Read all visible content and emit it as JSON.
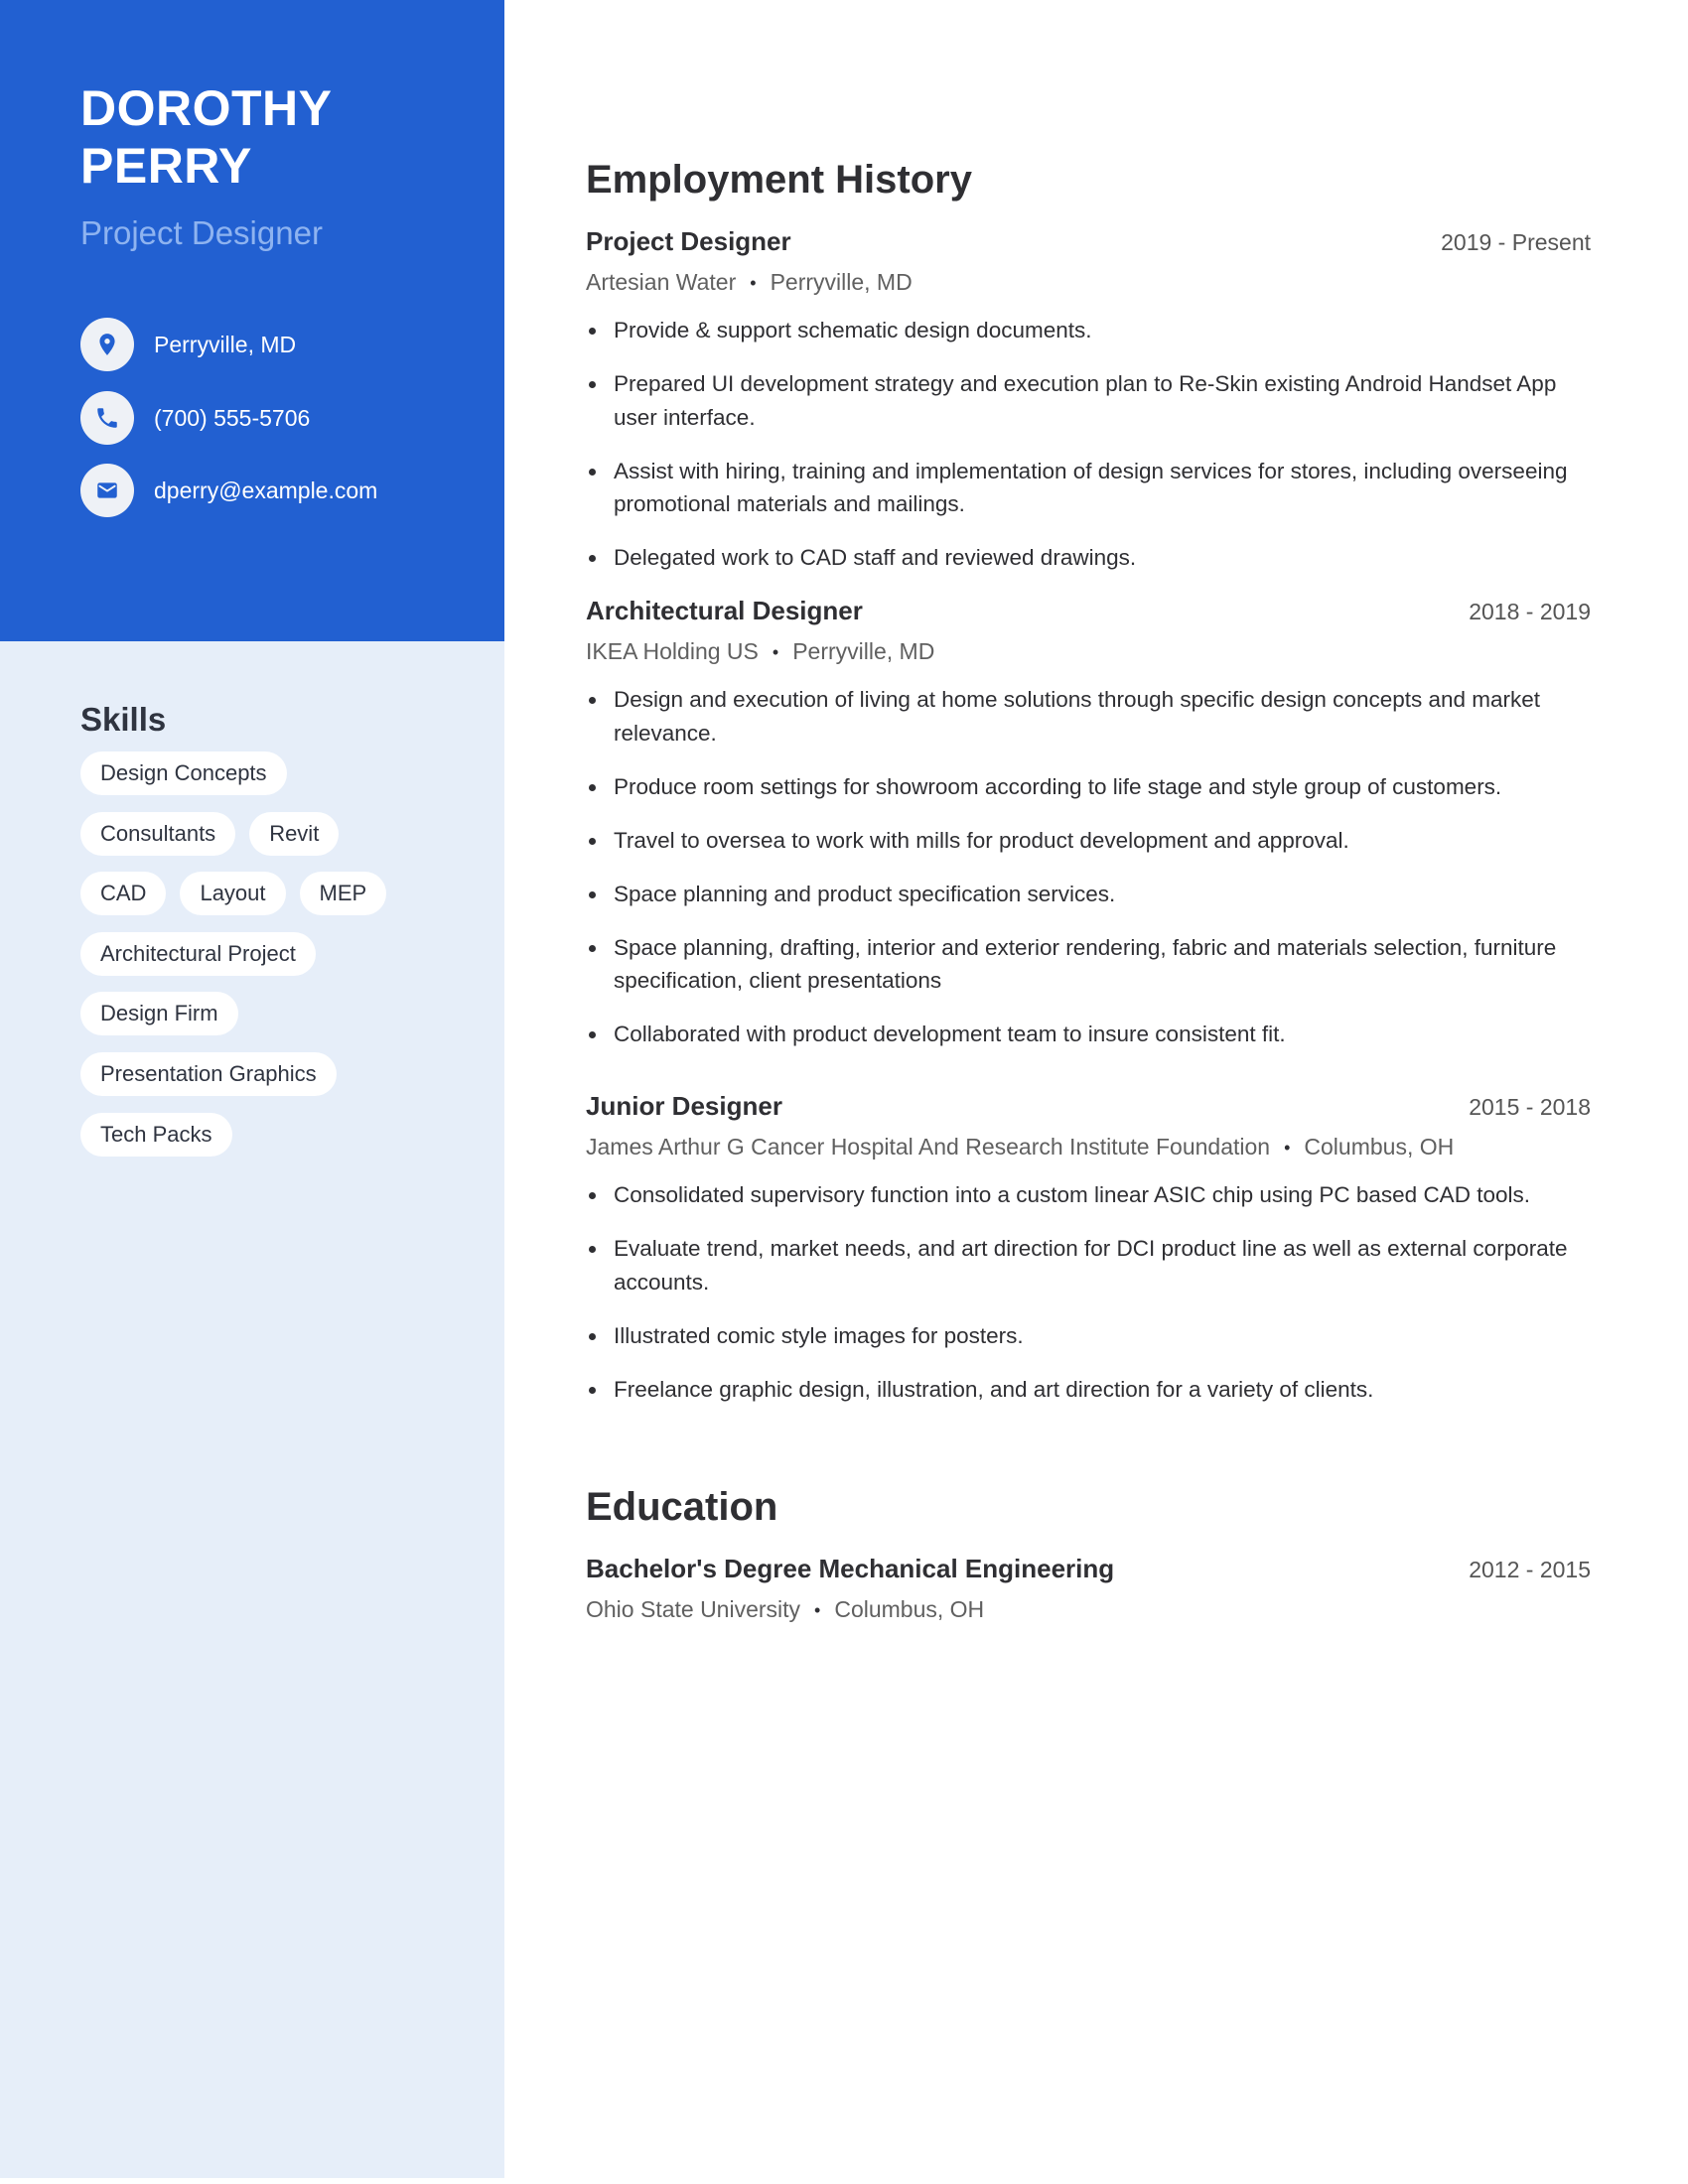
{
  "colors": {
    "accent": "#2260d1",
    "accent_light": "#8eb3f0",
    "sidebar_bg": "#e6eef9",
    "text": "#2f2f33",
    "muted": "#606060"
  },
  "profile": {
    "first_name": "DOROTHY",
    "last_name": "PERRY",
    "title": "Project Designer"
  },
  "contact": [
    {
      "icon": "location-pin-icon",
      "text": "Perryville, MD"
    },
    {
      "icon": "phone-icon",
      "text": "(700) 555-5706"
    },
    {
      "icon": "mail-icon",
      "text": "dperry@example.com"
    }
  ],
  "skills": {
    "title": "Skills",
    "rows": [
      [
        "Design Concepts"
      ],
      [
        "Consultants",
        "Revit"
      ],
      [
        "CAD",
        "Layout",
        "MEP"
      ],
      [
        "Architectural Project"
      ],
      [
        "Design Firm"
      ],
      [
        "Presentation Graphics"
      ],
      [
        "Tech Packs"
      ]
    ]
  },
  "employment": {
    "title": "Employment History",
    "jobs": [
      {
        "title": "Project Designer",
        "dates": "2019 - Present",
        "company": "Artesian Water",
        "location": "Perryville, MD",
        "bullets": [
          "Provide & support schematic design documents.",
          "Prepared UI development strategy and execution plan to Re-Skin existing Android Handset App user interface.",
          "Assist with hiring, training and implementation of design services for stores, including overseeing promotional materials and mailings.",
          "Delegated work to CAD staff and reviewed drawings."
        ]
      },
      {
        "title": "Architectural Designer",
        "dates": "2018 - 2019",
        "company": "IKEA Holding US",
        "location": "Perryville, MD",
        "bullets": [
          "Design and execution of living at home solutions through specific design concepts and market relevance.",
          "Produce room settings for showroom according to life stage and style group of customers.",
          "Travel to oversea to work with mills for product development and approval.",
          "Space planning and product specification services.",
          "Space planning, drafting, interior and exterior rendering, fabric and materials selection, furniture specification, client presentations",
          "Collaborated with product development team to insure consistent fit."
        ]
      },
      {
        "title": "Junior Designer",
        "dates": "2015 - 2018",
        "company": "James Arthur G Cancer Hospital And Research Institute Foundation",
        "location": "Columbus, OH",
        "bullets": [
          "Consolidated supervisory function into a custom linear ASIC chip using PC based CAD tools.",
          "Evaluate trend, market needs, and art direction for DCI product line as well as external corporate accounts.",
          "Illustrated comic style images for posters.",
          "Freelance graphic design, illustration, and art direction for a variety of clients."
        ]
      }
    ]
  },
  "education": {
    "title": "Education",
    "entries": [
      {
        "degree": "Bachelor's Degree Mechanical Engineering",
        "dates": "2012 - 2015",
        "school": "Ohio State University",
        "location": "Columbus, OH"
      }
    ]
  },
  "separator": "•"
}
